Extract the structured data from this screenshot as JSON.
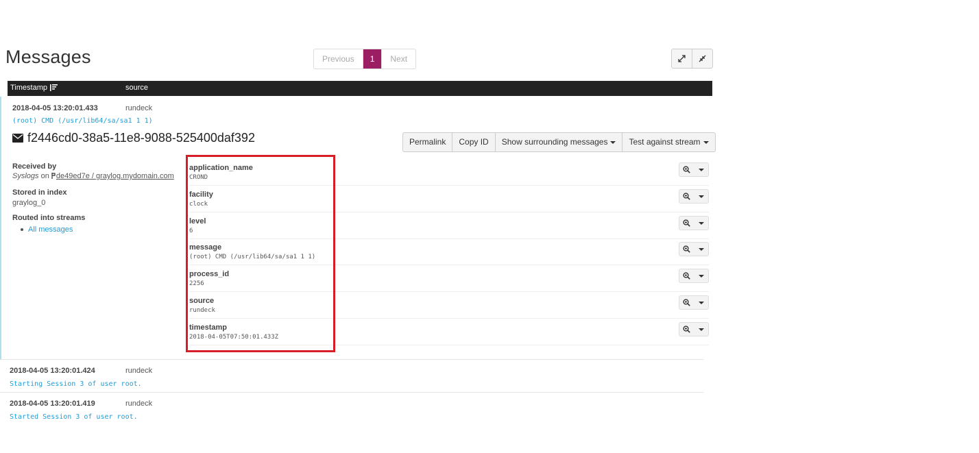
{
  "page": {
    "title": "Messages"
  },
  "pagination": {
    "previous": "Previous",
    "current": "1",
    "next": "Next"
  },
  "window_controls": {
    "expand_icon": "expand-icon",
    "compress_icon": "compress-icon"
  },
  "table": {
    "col_timestamp": "Timestamp",
    "col_source": "source",
    "sort_icon": "sort-amount-icon"
  },
  "expanded_message": {
    "timestamp": "2018-04-05 13:20:01.433",
    "source": "rundeck",
    "message": "(root) CMD (/usr/lib64/sa/sa1 1 1)",
    "id": "f2446cd0-38a5-11e8-9088-525400daf392",
    "actions": {
      "permalink": "Permalink",
      "copy_id": "Copy ID",
      "show_surrounding": "Show surrounding messages",
      "test_stream": "Test against stream"
    },
    "meta": {
      "received_by_label": "Received by",
      "received_by_input": "Syslogs",
      "received_on": "on",
      "received_node": "de49ed7e / graylog.mydomain.com",
      "stored_label": "Stored in index",
      "stored_value": "graylog_0",
      "routed_label": "Routed into streams",
      "stream": "All messages"
    },
    "fields": [
      {
        "name": "application_name",
        "value": "CROND"
      },
      {
        "name": "facility",
        "value": "clock"
      },
      {
        "name": "level",
        "value": "6"
      },
      {
        "name": "message",
        "value": "(root) CMD (/usr/lib64/sa/sa1 1 1)"
      },
      {
        "name": "process_id",
        "value": "2256"
      },
      {
        "name": "source",
        "value": "rundeck"
      },
      {
        "name": "timestamp",
        "value": "2018-04-05T07:50:01.433Z"
      }
    ]
  },
  "rows": [
    {
      "timestamp": "2018-04-05 13:20:01.424",
      "source": "rundeck",
      "message": "Starting Session 3 of user root."
    },
    {
      "timestamp": "2018-04-05 13:20:01.419",
      "source": "rundeck",
      "message": "Started Session 3 of user root."
    }
  ],
  "colors": {
    "accent": "#9b1e63",
    "link": "#1e9bd7",
    "highlight": "#d71e28",
    "table_header": "#222222"
  }
}
